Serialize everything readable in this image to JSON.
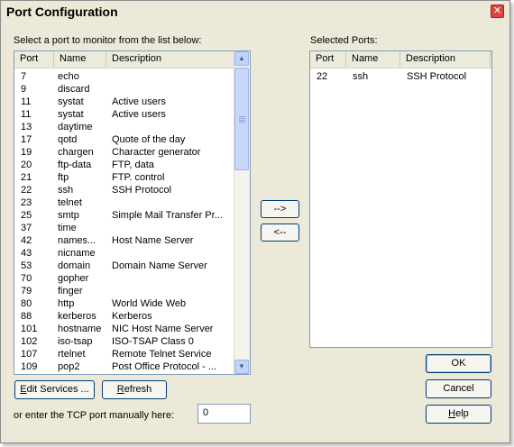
{
  "window": {
    "title": "Port Configuration",
    "close_glyph": "✕"
  },
  "available": {
    "label": "Select a port to monitor from the list below:",
    "columns": [
      "Port",
      "Name",
      "Description"
    ],
    "rows": [
      [
        "7",
        "echo",
        ""
      ],
      [
        "9",
        "discard",
        ""
      ],
      [
        "11",
        "systat",
        "Active users"
      ],
      [
        "11",
        "systat",
        "Active users"
      ],
      [
        "13",
        "daytime",
        ""
      ],
      [
        "17",
        "qotd",
        "Quote of the day"
      ],
      [
        "19",
        "chargen",
        "Character generator"
      ],
      [
        "20",
        "ftp-data",
        "FTP, data"
      ],
      [
        "21",
        "ftp",
        "FTP. control"
      ],
      [
        "22",
        "ssh",
        "SSH Protocol"
      ],
      [
        "23",
        "telnet",
        ""
      ],
      [
        "25",
        "smtp",
        "Simple Mail Transfer Pr..."
      ],
      [
        "37",
        "time",
        ""
      ],
      [
        "42",
        "names...",
        "Host Name Server"
      ],
      [
        "43",
        "nicname",
        ""
      ],
      [
        "53",
        "domain",
        "Domain Name Server"
      ],
      [
        "70",
        "gopher",
        ""
      ],
      [
        "79",
        "finger",
        ""
      ],
      [
        "80",
        "http",
        "World Wide Web"
      ],
      [
        "88",
        "kerberos",
        "Kerberos"
      ],
      [
        "101",
        "hostname",
        "NIC Host Name Server"
      ],
      [
        "102",
        "iso-tsap",
        "ISO-TSAP Class 0"
      ],
      [
        "107",
        "rtelnet",
        "Remote Telnet Service"
      ],
      [
        "109",
        "pop2",
        "Post Office Protocol - ..."
      ]
    ]
  },
  "selected": {
    "label": "Selected Ports:",
    "columns": [
      "Port",
      "Name",
      "Description"
    ],
    "rows": [
      [
        "22",
        "ssh",
        "SSH Protocol"
      ]
    ]
  },
  "buttons": {
    "add": "-->",
    "remove": "<--",
    "edit_services_prefix": "E",
    "edit_services_rest": "dit Services ...",
    "refresh_prefix": "R",
    "refresh_rest": "efresh",
    "ok": "OK",
    "cancel": "Cancel",
    "help_prefix": "H",
    "help_rest": "elp"
  },
  "manual": {
    "label": "or enter the TCP port manually here:",
    "value": "0"
  },
  "scrollbar": {
    "up_glyph": "▲",
    "down_glyph": "▼"
  }
}
